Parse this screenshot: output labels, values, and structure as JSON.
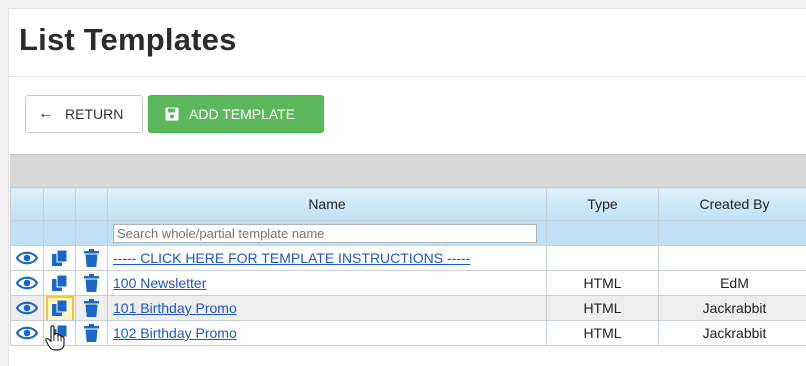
{
  "page": {
    "title": "List Templates"
  },
  "toolbar": {
    "return_label": "RETURN",
    "add_label": "ADD TEMPLATE"
  },
  "grid": {
    "columns": {
      "name": "Name",
      "type": "Type",
      "created_by": "Created By"
    },
    "search": {
      "placeholder": "Search whole/partial template name"
    },
    "rows": [
      {
        "name": "----- CLICK HERE FOR TEMPLATE INSTRUCTIONS -----",
        "type": "",
        "created_by": ""
      },
      {
        "name": "100 Newsletter",
        "type": "HTML",
        "created_by": "EdM"
      },
      {
        "name": "101 Birthday Promo",
        "type": "HTML",
        "created_by": "Jackrabbit"
      },
      {
        "name": "102 Birthday Promo",
        "type": "HTML",
        "created_by": "Jackrabbit"
      }
    ]
  },
  "icons": {
    "view": "eye-icon",
    "copy": "copy-icon",
    "delete": "trash-icon",
    "save": "floppy-icon",
    "back": "arrow-left-icon"
  },
  "colors": {
    "link": "#1d56c9",
    "icon_blue": "#1a67c9",
    "add_button": "#5cb85c",
    "header_blue": "#bfe1f3",
    "highlight": "#f4c72c"
  }
}
